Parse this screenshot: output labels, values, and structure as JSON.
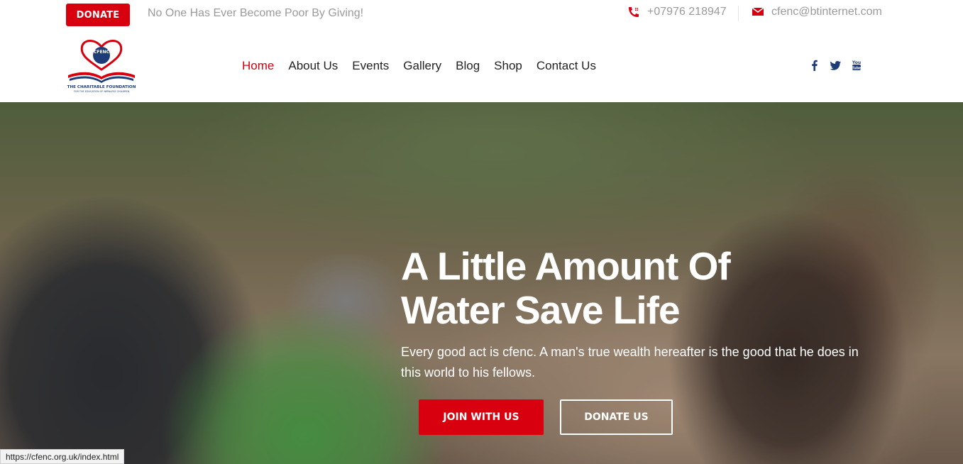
{
  "topbar": {
    "donate_label": "DONATE",
    "tagline": "No One Has Ever Become Poor By Giving!",
    "phone": "+07976 218947",
    "email": "cfenc@btinternet.com"
  },
  "logo": {
    "acronym": "CFENC",
    "line1": "THE CHARITABLE FOUNDATION",
    "line2": "FOR THE EDUCATION OF NEPALESE CHILDREN"
  },
  "nav": {
    "items": [
      "Home",
      "About Us",
      "Events",
      "Gallery",
      "Blog",
      "Shop",
      "Contact Us"
    ],
    "active": "Home"
  },
  "social": [
    "facebook-icon",
    "twitter-icon",
    "youtube-icon"
  ],
  "hero": {
    "title_line1": "A Little Amount Of",
    "title_line2": "Water Save Life",
    "subtitle": "Every good act is cfenc. A man's true wealth hereafter is the good that he does in this world to his fellows.",
    "join_label": "JOIN WITH US",
    "donate_label": "DONATE US"
  },
  "status_url": "https://cfenc.org.uk/index.html",
  "colors": {
    "accent": "#d8000f",
    "brand_blue": "#1d3d78",
    "muted_text": "#9a9a9a"
  }
}
